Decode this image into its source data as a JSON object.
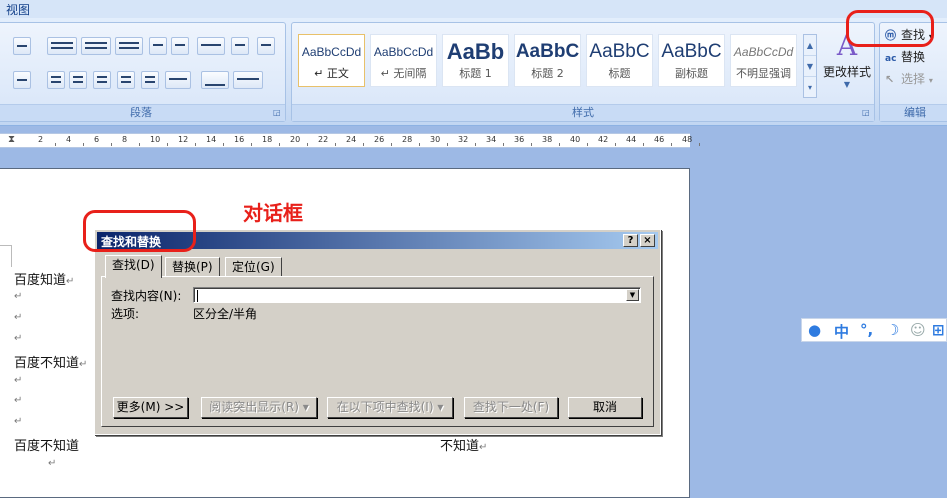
{
  "ribbon": {
    "tab_label": "视图",
    "groups": {
      "paragraph": "段落",
      "styles": "样式",
      "editing": "编辑"
    },
    "styles": [
      {
        "sample": "AaBbCcDd",
        "name": "↵ 正文"
      },
      {
        "sample": "AaBbCcDd",
        "name": "↵ 无间隔"
      },
      {
        "sample": "AaBb",
        "name": "标题 1"
      },
      {
        "sample": "AaBbC",
        "name": "标题 2"
      },
      {
        "sample": "AaBbC",
        "name": "标题"
      },
      {
        "sample": "AaBbC",
        "name": "副标题"
      },
      {
        "sample": "AaBbCcDd",
        "name": "不明显强调"
      }
    ],
    "change_styles": "更改样式",
    "editing": {
      "find": "查找",
      "replace": "替换",
      "select": "选择"
    }
  },
  "ruler": {
    "ticks": [
      "2",
      "4",
      "6",
      "8",
      "10",
      "12",
      "14",
      "16",
      "18",
      "20",
      "22",
      "24",
      "26",
      "28",
      "30",
      "32",
      "34",
      "36",
      "38",
      "40",
      "42",
      "44",
      "46",
      "48"
    ]
  },
  "annotation": {
    "label": "对话框"
  },
  "document": {
    "lines": [
      "百度知道",
      "百度不知道",
      "百度不知道",
      "不知道"
    ],
    "para_mark": "↵"
  },
  "dialog": {
    "title": "查找和替换",
    "help": "?",
    "close": "×",
    "tabs": [
      "查找(D)",
      "替换(P)",
      "定位(G)"
    ],
    "find_label": "查找内容(N):",
    "find_value": "",
    "options_label": "选项:",
    "options_value": "区分全/半角",
    "buttons": {
      "more": "更多(M) >>",
      "highlight": "阅读突出显示(R) ▾",
      "find_in": "在以下项中查找(I) ▾",
      "find_next": "查找下一处(F)",
      "cancel": "取消"
    }
  },
  "ime": {
    "items": [
      "中",
      "°,",
      "☽",
      "☺",
      "⊞"
    ]
  }
}
